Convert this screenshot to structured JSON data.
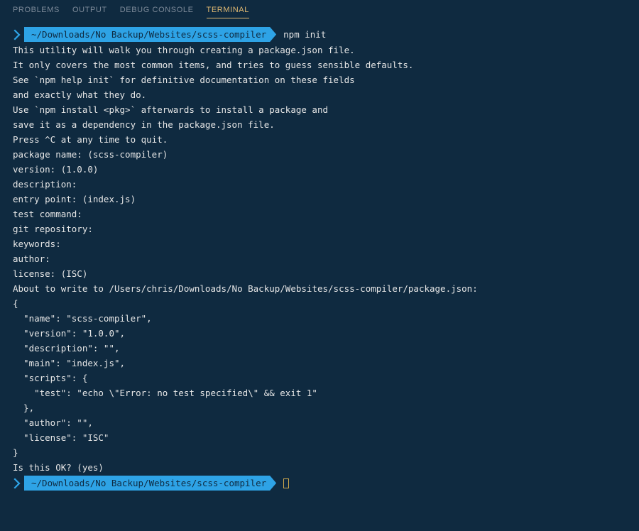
{
  "tabs": {
    "problems": "PROBLEMS",
    "output": "OUTPUT",
    "debug": "DEBUG CONSOLE",
    "terminal": "TERMINAL"
  },
  "prompt": {
    "path": "~/Downloads/No Backup/Websites/scss-compiler"
  },
  "commands": {
    "init": "npm init"
  },
  "output": {
    "l1": "This utility will walk you through creating a package.json file.",
    "l2": "It only covers the most common items, and tries to guess sensible defaults.",
    "l3": "",
    "l4": "See `npm help init` for definitive documentation on these fields",
    "l5": "and exactly what they do.",
    "l6": "",
    "l7": "Use `npm install <pkg>` afterwards to install a package and",
    "l8": "save it as a dependency in the package.json file.",
    "l9": "",
    "l10": "Press ^C at any time to quit.",
    "l11": "package name: (scss-compiler)",
    "l12": "version: (1.0.0)",
    "l13": "description:",
    "l14": "entry point: (index.js)",
    "l15": "test command:",
    "l16": "git repository:",
    "l17": "keywords:",
    "l18": "author:",
    "l19": "license: (ISC)",
    "l20": "About to write to /Users/chris/Downloads/No Backup/Websites/scss-compiler/package.json:",
    "l21": "",
    "l22": "{",
    "l23": "  \"name\": \"scss-compiler\",",
    "l24": "  \"version\": \"1.0.0\",",
    "l25": "  \"description\": \"\",",
    "l26": "  \"main\": \"index.js\",",
    "l27": "  \"scripts\": {",
    "l28": "    \"test\": \"echo \\\"Error: no test specified\\\" && exit 1\"",
    "l29": "  },",
    "l30": "  \"author\": \"\",",
    "l31": "  \"license\": \"ISC\"",
    "l32": "}",
    "l33": "",
    "l34": "",
    "l35": "Is this OK? (yes)"
  }
}
